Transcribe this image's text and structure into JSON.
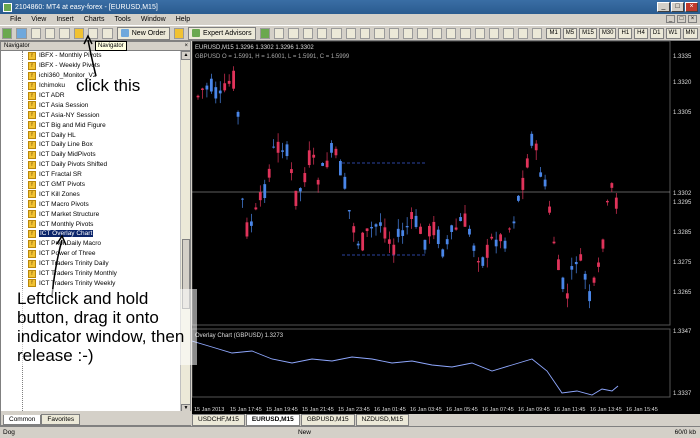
{
  "window": {
    "title": "2104860: MT4 at easy-forex - [EURUSD,M15]",
    "min": "_",
    "max": "□",
    "close": "×"
  },
  "menu": [
    "File",
    "View",
    "Insert",
    "Charts",
    "Tools",
    "Window",
    "Help"
  ],
  "toolbar": {
    "new_order": "New Order",
    "expert_advisors": "Expert Advisors",
    "timeframes": [
      "M1",
      "M5",
      "M15",
      "M30",
      "H1",
      "H4",
      "D1",
      "W1",
      "MN"
    ],
    "tooltip": "Navigator"
  },
  "navigator": {
    "title": "Navigator",
    "items": [
      {
        "label": "IBFX - Monthly Pivots",
        "selected": false
      },
      {
        "label": "IBFX - Weekly Pivots",
        "selected": false
      },
      {
        "label": "ichi360_Monitor_V2",
        "selected": false
      },
      {
        "label": "Ichimoku",
        "selected": false
      },
      {
        "label": "ICT ADR",
        "selected": false
      },
      {
        "label": "ICT Asia Session",
        "selected": false
      },
      {
        "label": "ICT Asia-NY Session",
        "selected": false
      },
      {
        "label": "ICT Big and Mid Figure",
        "selected": false
      },
      {
        "label": "ICT Daily HL",
        "selected": false
      },
      {
        "label": "ICT Daily Line Box",
        "selected": false
      },
      {
        "label": "ICT Daily MidPivots",
        "selected": false
      },
      {
        "label": "ICT Daily Pivots Shifted",
        "selected": false
      },
      {
        "label": "ICT Fractal SR",
        "selected": false
      },
      {
        "label": "ICT GMT Pivots",
        "selected": false
      },
      {
        "label": "ICT Kill Zones",
        "selected": false
      },
      {
        "label": "ICT Macro Pivots",
        "selected": false
      },
      {
        "label": "ICT Market Structure",
        "selected": false
      },
      {
        "label": "ICT Monthly Pivots",
        "selected": false
      },
      {
        "label": "ICT Overlay Chart",
        "selected": true
      },
      {
        "label": "ICT Prior Daily Macro",
        "selected": false
      },
      {
        "label": "ICT Power of Three",
        "selected": false
      },
      {
        "label": "ICT Traders Trinity Daily",
        "selected": false
      },
      {
        "label": "ICT Traders Trinity Monthly",
        "selected": false
      },
      {
        "label": "ICT Traders Trinity Weekly",
        "selected": false
      }
    ],
    "tabs": [
      "Common",
      "Favorites"
    ]
  },
  "annotations": {
    "click_this": "click this",
    "instructions": "Leftclick and hold button, drag it onto indicator window, then release :-)"
  },
  "chart": {
    "main_label": "EURUSD,M15  1.3296 1.3302 1.3296 1.3302",
    "overlay_info": "GBPUSD O = 1.5991, H = 1.6001, L = 1.5991, C = 1.5999",
    "sub_label": "Overlay Chart (GBPUSD) 1.3273",
    "price_axis": [
      "1.3335",
      "1.3320",
      "1.3305",
      "1.3302",
      "1.3295",
      "1.3285",
      "1.3275",
      "1.3265",
      "1.3347",
      "1.3337"
    ],
    "time_axis": [
      "15 Jan 2013",
      "15 Jan 17:45",
      "15 Jan 19:45",
      "15 Jan 21:45",
      "15 Jan 23:45",
      "16 Jan 01:45",
      "16 Jan 03:45",
      "16 Jan 05:45",
      "16 Jan 07:45",
      "16 Jan 09:45",
      "16 Jan 11:45",
      "16 Jan 13:45",
      "16 Jan 15:45"
    ],
    "colors": {
      "bull": "#4a86e8",
      "bear": "#e0335a",
      "bg": "#000000",
      "grid": "#3a3a3a",
      "line": "#8fa8ff"
    },
    "tabs": [
      {
        "label": "USDCHF,M15",
        "active": false
      },
      {
        "label": "EURUSD,M15",
        "active": true
      },
      {
        "label": "GBPUSD,M15",
        "active": false
      },
      {
        "label": "NZDUSD,M15",
        "active": false
      }
    ]
  },
  "status": {
    "left": "Dog",
    "mid": "New",
    "right": "60/0 kb"
  }
}
